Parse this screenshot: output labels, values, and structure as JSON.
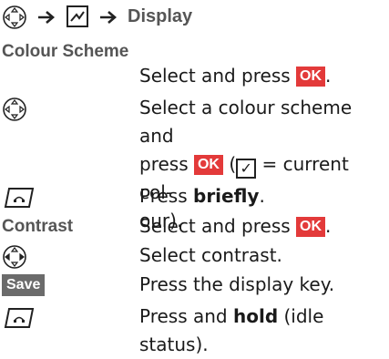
{
  "breadcrumb": {
    "title": "Display",
    "nav_icon": "nav-key-icon",
    "menu_icon": "menu-icon"
  },
  "colour_scheme": {
    "label": "Colour Scheme",
    "step1": "Select and press",
    "ok": "OK",
    "step2_line1": "Select a colour scheme and",
    "step2_press": "press",
    "step2_check": "✓",
    "step2_rest": "= current col-",
    "step2_line3": "our).",
    "step3_pre": "Press",
    "step3_bold": "briefly",
    "step3_post": "."
  },
  "contrast": {
    "label": "Contrast",
    "step1": "Select and press",
    "step2": "Select contrast."
  },
  "save": {
    "key": "Save",
    "desc": "Press the display key.",
    "final_pre": "Press and",
    "final_bold": "hold",
    "final_post": "(idle status)."
  },
  "colors": {
    "ok_bg": "#e33a3a",
    "key_bg": "#6b6b6b",
    "label": "#555555"
  }
}
